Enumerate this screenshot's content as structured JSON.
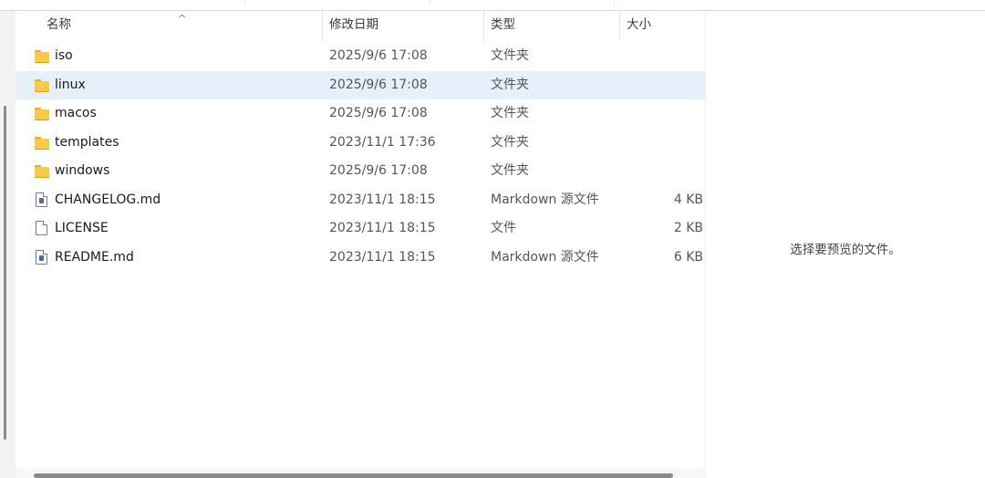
{
  "columns": {
    "name": "名称",
    "date": "修改日期",
    "type": "类型",
    "size": "大小"
  },
  "files": [
    {
      "name": "iso",
      "date": "2025/9/6 17:08",
      "type": "文件夹",
      "size": "",
      "icon": "folder-icon",
      "selected": false
    },
    {
      "name": "linux",
      "date": "2025/9/6 17:08",
      "type": "文件夹",
      "size": "",
      "icon": "folder-icon",
      "selected": true
    },
    {
      "name": "macos",
      "date": "2025/9/6 17:08",
      "type": "文件夹",
      "size": "",
      "icon": "folder-icon",
      "selected": false
    },
    {
      "name": "templates",
      "date": "2023/11/1 17:36",
      "type": "文件夹",
      "size": "",
      "icon": "folder-icon",
      "selected": false
    },
    {
      "name": "windows",
      "date": "2025/9/6 17:08",
      "type": "文件夹",
      "size": "",
      "icon": "folder-icon",
      "selected": false
    },
    {
      "name": "CHANGELOG.md",
      "date": "2023/11/1 18:15",
      "type": "Markdown 源文件",
      "size": "4 KB",
      "icon": "markdown-file-icon",
      "selected": false
    },
    {
      "name": "LICENSE",
      "date": "2023/11/1 18:15",
      "type": "文件",
      "size": "2 KB",
      "icon": "file-icon",
      "selected": false
    },
    {
      "name": "README.md",
      "date": "2023/11/1 18:15",
      "type": "Markdown 源文件",
      "size": "6 KB",
      "icon": "markdown-file-icon",
      "selected": false
    }
  ],
  "preview": {
    "message": "选择要预览的文件。"
  },
  "colors": {
    "selection": "#e5f0fb",
    "folder": "#f8c94a"
  }
}
